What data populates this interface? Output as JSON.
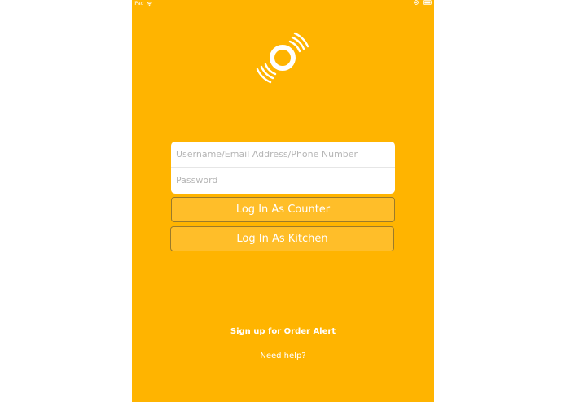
{
  "status_bar": {
    "device_name": "iPad",
    "wifi_icon": "wifi-icon",
    "lock_icon": "rotation-lock-icon",
    "battery_icon": "battery-icon"
  },
  "logo": {
    "icon": "ring-with-signal-waves-icon",
    "color": "#FFFFFF"
  },
  "login_form": {
    "username_placeholder": "Username/Email Address/Phone Number",
    "username_value": "",
    "password_placeholder": "Password",
    "password_value": ""
  },
  "buttons": {
    "counter_label": "Log In As Counter",
    "kitchen_label": "Log In As Kitchen"
  },
  "links": {
    "signup_label": "Sign up for Order Alert",
    "help_label": "Need help?"
  },
  "colors": {
    "background": "#FFB400",
    "button_fill": "#FFBE29",
    "button_border": "#9B7A2A",
    "text": "#FFFFFF"
  }
}
